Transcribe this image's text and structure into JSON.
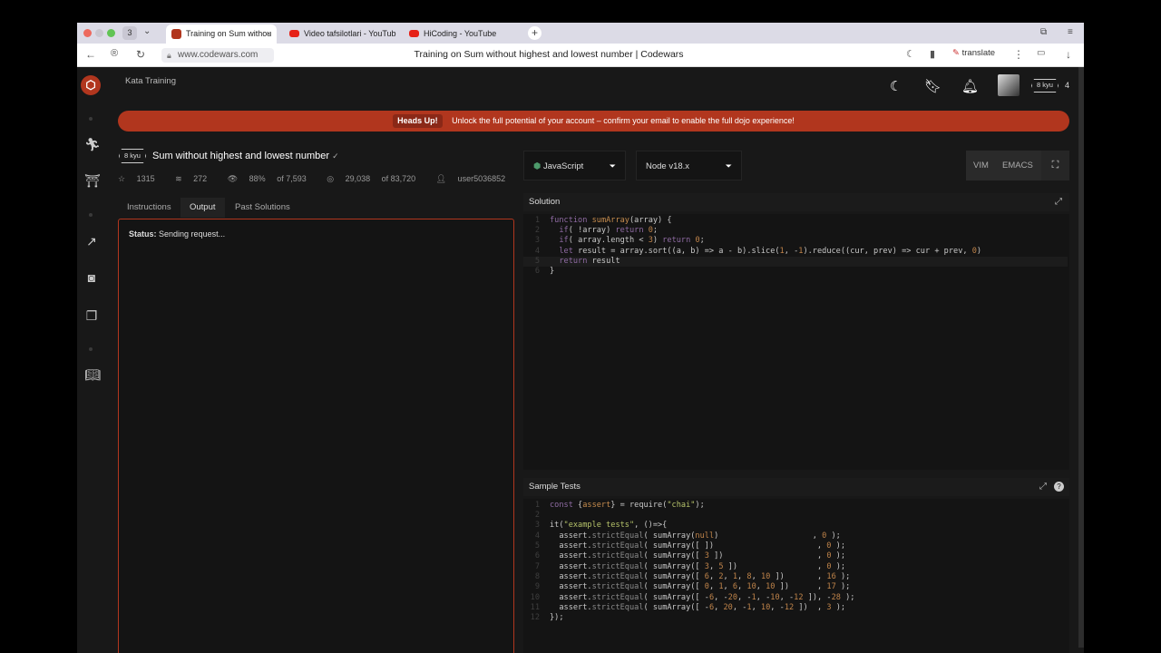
{
  "browser": {
    "tab_count": "3",
    "tabs": [
      {
        "title": "Training on Sum withou",
        "close": "×"
      },
      {
        "title": "Video tafsilotlari - YouTub"
      },
      {
        "title": "HiCoding - YouTube"
      }
    ],
    "new_tab": "+",
    "url": "www.codewars.com",
    "page_title": "Training on Sum without highest and lowest number | Codewars",
    "translate_label": "translate"
  },
  "header": {
    "breadcrumb": "Kata Training",
    "rank_badge": "8 kyu",
    "honor": "4"
  },
  "banner": {
    "label": "Heads Up!",
    "message": "Unlock the full potential of your account – confirm your email to enable the full dojo experience!"
  },
  "kata": {
    "rank": "8 kyu",
    "title": "Sum without highest and lowest number",
    "stars": "1315",
    "collections": "272",
    "satisfaction": "88%",
    "satisfaction_of": "of 7,593",
    "completed": "29,038",
    "completed_of": "of 83,720",
    "author": "user5036852"
  },
  "left_tabs": [
    "Instructions",
    "Output",
    "Past Solutions"
  ],
  "output": {
    "status_label": "Status:",
    "status_text": "Sending request..."
  },
  "editor_controls": {
    "language": "JavaScript",
    "runtime": "Node v18.x",
    "vim": "VIM",
    "emacs": "EMACS"
  },
  "solution": {
    "title": "Solution",
    "lines": [
      "function sumArray(array) {",
      "  if( !array) return 0;",
      "  if( array.length < 3) return 0;",
      "  let result = array.sort((a, b) => a - b).slice(1, -1).reduce((cur, prev) => cur + prev, 0)",
      "  return result",
      "}"
    ]
  },
  "sample_tests": {
    "title": "Sample Tests",
    "lines": [
      "const {assert} = require(\"chai\");",
      "",
      "it(\"example tests\", ()=>{",
      "  assert.strictEqual( sumArray(null)                    , 0 );",
      "  assert.strictEqual( sumArray([ ])                      , 0 );",
      "  assert.strictEqual( sumArray([ 3 ])                    , 0 );",
      "  assert.strictEqual( sumArray([ 3, 5 ])                 , 0 );",
      "  assert.strictEqual( sumArray([ 6, 2, 1, 8, 10 ])       , 16 );",
      "  assert.strictEqual( sumArray([ 0, 1, 6, 10, 10 ])      , 17 );",
      "  assert.strictEqual( sumArray([ -6, -20, -1, -10, -12 ]), -28 );",
      "  assert.strictEqual( sumArray([ -6, 20, -1, 10, -12 ])  , 3 );",
      "});"
    ]
  },
  "colors": {
    "brand": "#b1361e",
    "background": "#181818",
    "editor_bg": "#141414"
  }
}
